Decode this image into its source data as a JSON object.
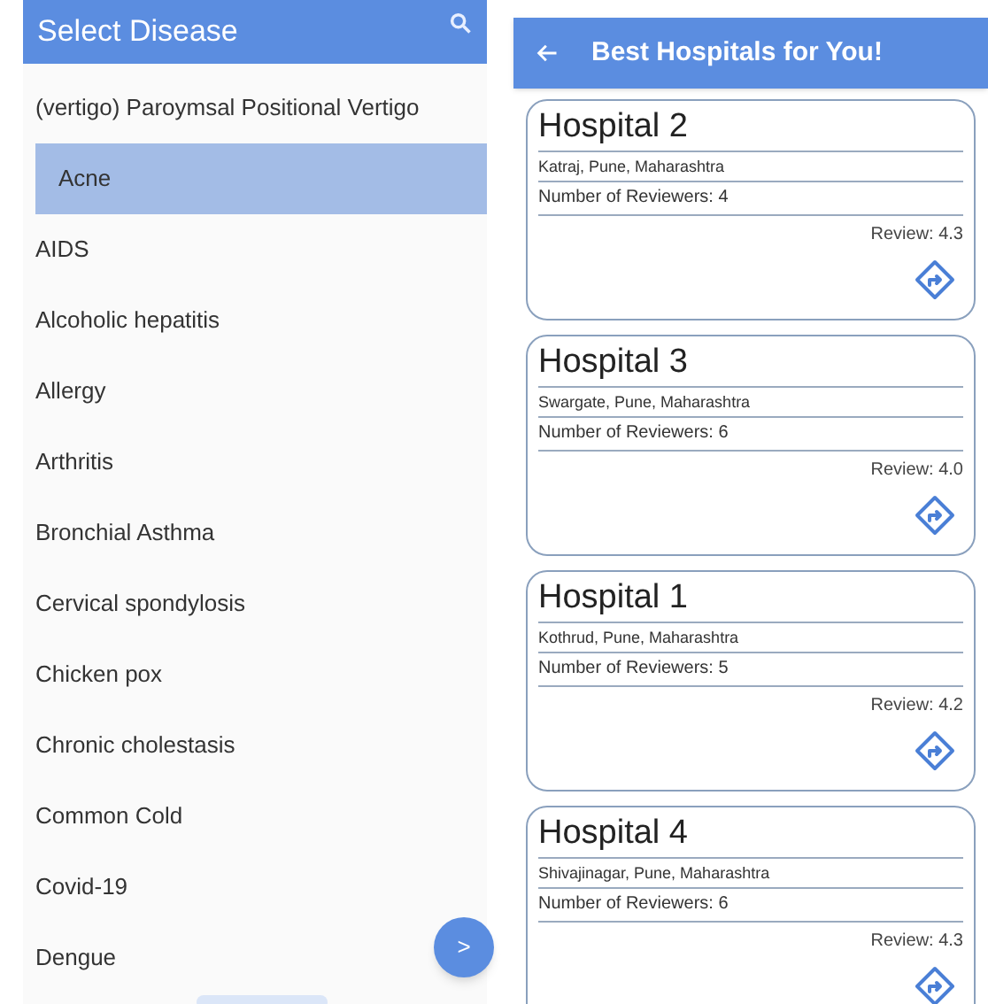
{
  "disease_screen": {
    "title": "Select Disease",
    "items": [
      {
        "label": "(vertigo) Paroymsal  Positional Vertigo",
        "selected": false
      },
      {
        "label": "Acne",
        "selected": true
      },
      {
        "label": "AIDS",
        "selected": false
      },
      {
        "label": "Alcoholic hepatitis",
        "selected": false
      },
      {
        "label": "Allergy",
        "selected": false
      },
      {
        "label": "Arthritis",
        "selected": false
      },
      {
        "label": "Bronchial Asthma",
        "selected": false
      },
      {
        "label": "Cervical spondylosis",
        "selected": false
      },
      {
        "label": "Chicken pox",
        "selected": false
      },
      {
        "label": "Chronic cholestasis",
        "selected": false
      },
      {
        "label": "Common Cold",
        "selected": false
      },
      {
        "label": "Covid-19",
        "selected": false
      },
      {
        "label": "Dengue",
        "selected": false
      }
    ],
    "next_button": ">"
  },
  "hospital_screen": {
    "title": "Best Hospitals for You!",
    "hospitals": [
      {
        "name": "Hospital 2",
        "address": "Katraj, Pune, Maharashtra",
        "reviewers": "Number of Reviewers: 4",
        "review": "Review: 4.3"
      },
      {
        "name": "Hospital 3",
        "address": "Swargate, Pune, Maharashtra",
        "reviewers": "Number of Reviewers: 6",
        "review": "Review: 4.0"
      },
      {
        "name": "Hospital 1",
        "address": "Kothrud, Pune, Maharashtra",
        "reviewers": "Number of Reviewers: 5",
        "review": "Review: 4.2"
      },
      {
        "name": "Hospital 4",
        "address": "Shivajinagar, Pune, Maharashtra",
        "reviewers": "Number of Reviewers: 6",
        "review": "Review: 4.3"
      }
    ]
  }
}
